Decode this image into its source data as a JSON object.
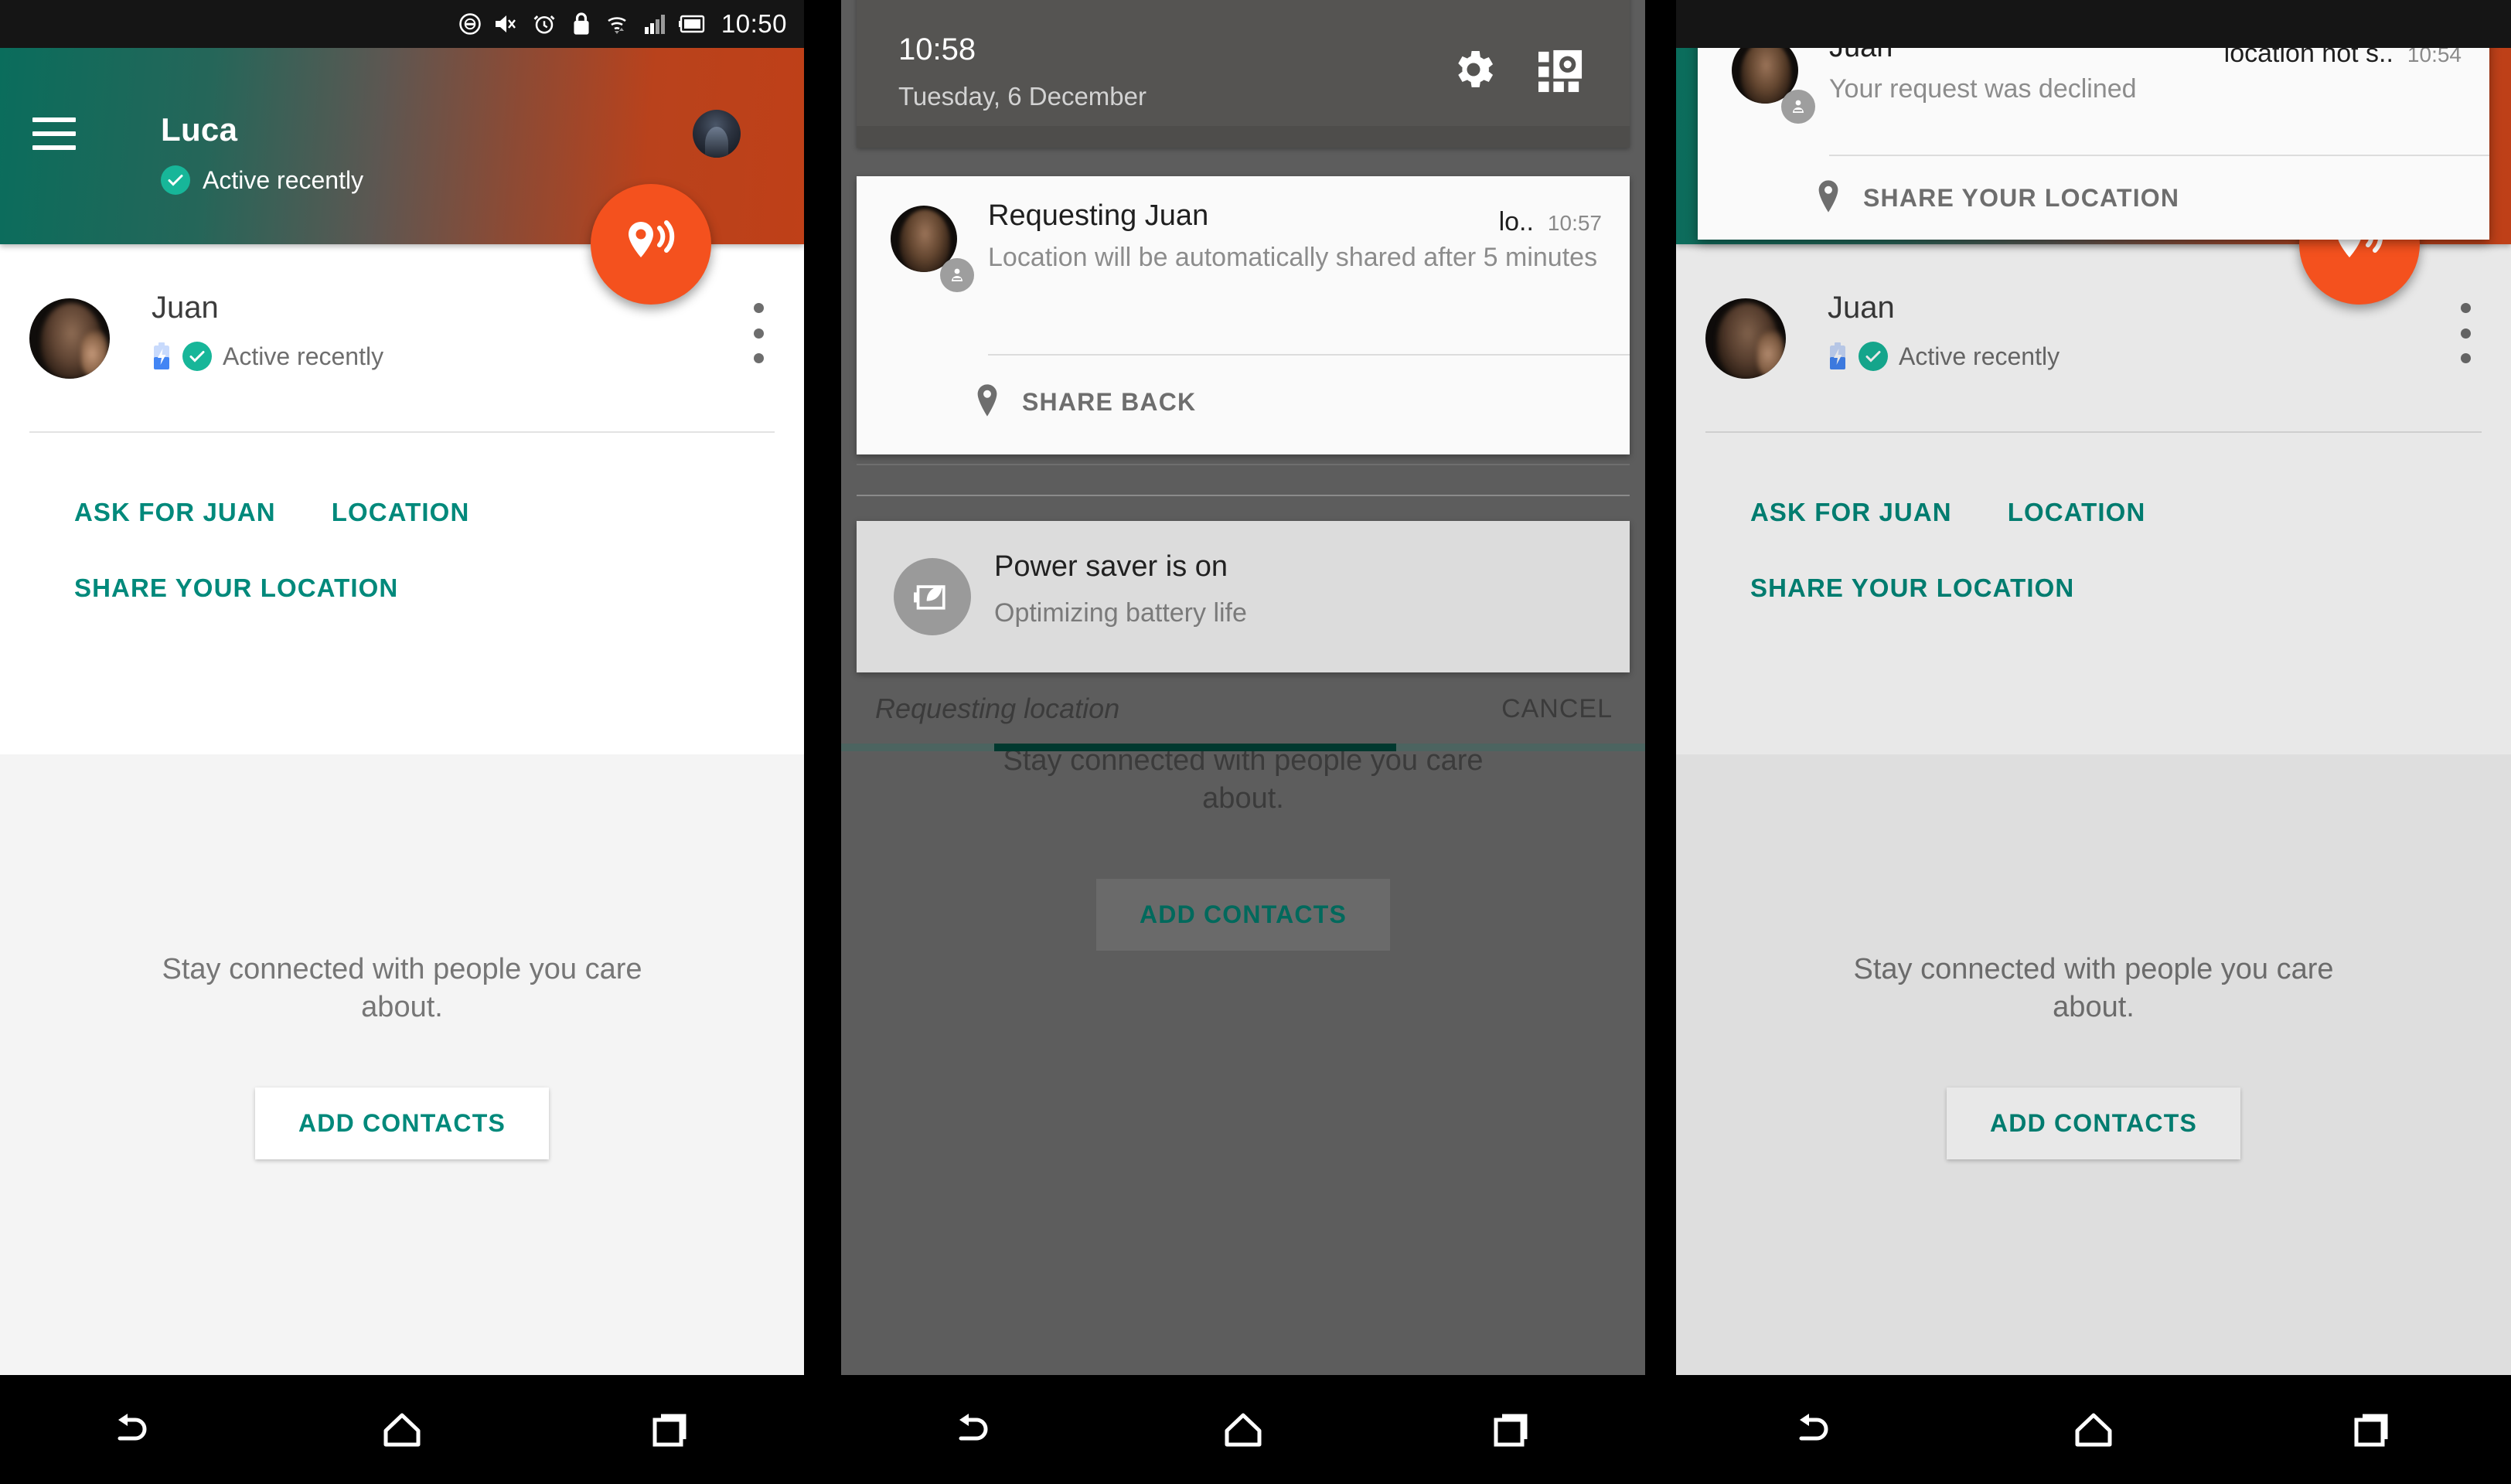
{
  "panel1": {
    "statusbar": {
      "time": "10:50",
      "icons": [
        "do-not-disturb-icon",
        "volume-mute-icon",
        "alarm-icon",
        "lock-icon",
        "wifi-icon",
        "cellular-signal-icon",
        "battery-icon"
      ]
    },
    "appbar": {
      "title": "Luca",
      "status": "Active recently",
      "menu_icon": "hamburger-menu-icon",
      "avatar": "user-avatar"
    },
    "fab": {
      "icon": "location-broadcast-icon",
      "color": "#f4511e"
    },
    "contact": {
      "name": "Juan",
      "status": "Active recently",
      "battery_icon": "battery-charging-icon",
      "overflow_icon": "more-vertical-icon"
    },
    "actions": {
      "ask": "ASK FOR JUAN",
      "location": "LOCATION",
      "share": "SHARE YOUR LOCATION"
    },
    "empty": {
      "message": "Stay connected with people you care about.",
      "add_contacts": "ADD CONTACTS"
    },
    "navbar": [
      "back-icon",
      "home-icon",
      "recents-icon"
    ]
  },
  "panel2": {
    "shade": {
      "time": "10:58",
      "date": "Tuesday, 6 December",
      "settings_icon": "gear-icon",
      "quicksettings_icon": "quick-settings-icon"
    },
    "notification": {
      "title": "Requesting Juan",
      "app": "lo..",
      "timestamp": "10:57",
      "body": "Location will be automatically shared after 5 minutes",
      "action": "SHARE BACK",
      "action_icon": "location-pin-icon",
      "avatar_badge_icon": "person-badge-icon"
    },
    "powersaver": {
      "title": "Power saver is on",
      "subtitle": "Optimizing battery life",
      "icon": "leaf-battery-icon"
    },
    "snackbar": {
      "label": "Requesting location",
      "cancel": "CANCEL",
      "progress_color": "#00392f"
    },
    "empty": {
      "message": "Stay connected with people you care about.",
      "add_contacts": "ADD CONTACTS"
    },
    "navbar": [
      "back-icon",
      "home-icon",
      "recents-icon"
    ]
  },
  "panel3": {
    "notification": {
      "title": "Juan",
      "app": "location not s..",
      "timestamp": "10:54",
      "body": "Your request was declined",
      "action": "SHARE YOUR LOCATION",
      "action_icon": "location-pin-icon",
      "avatar_badge_icon": "person-badge-icon"
    },
    "contact": {
      "name": "Juan",
      "status": "Active recently",
      "battery_icon": "battery-charging-icon",
      "overflow_icon": "more-vertical-icon"
    },
    "actions": {
      "ask": "ASK FOR JUAN",
      "location": "LOCATION",
      "share": "SHARE YOUR LOCATION"
    },
    "empty": {
      "message": "Stay connected with people you care about.",
      "add_contacts": "ADD CONTACTS"
    },
    "fab": {
      "icon": "location-broadcast-icon",
      "color": "#f4511e"
    },
    "navbar": [
      "back-icon",
      "home-icon",
      "recents-icon"
    ]
  }
}
